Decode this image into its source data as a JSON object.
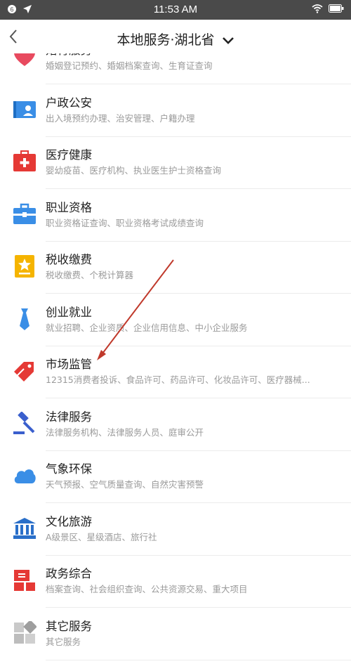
{
  "status": {
    "time": "11:53 AM"
  },
  "header": {
    "title": "本地服务·湖北省"
  },
  "items": [
    {
      "title": "婚育服务",
      "sub": "婚姻登记预约、婚姻档案查询、生育证查询",
      "icon": "heart-icon",
      "color": "#e84a5f"
    },
    {
      "title": "户政公安",
      "sub": "出入境预约办理、治安管理、户籍办理",
      "icon": "id-card-icon",
      "color": "#3a8ee6"
    },
    {
      "title": "医疗健康",
      "sub": "婴幼疫苗、医疗机构、执业医生护士资格查询",
      "icon": "medical-kit-icon",
      "color": "#e53935"
    },
    {
      "title": "职业资格",
      "sub": "职业资格证查询、职业资格考试成绩查询",
      "icon": "briefcase-icon",
      "color": "#3a8ee6"
    },
    {
      "title": "税收缴费",
      "sub": "税收缴费、个税计算器",
      "icon": "tax-star-icon",
      "color": "#f5b400"
    },
    {
      "title": "创业就业",
      "sub": "就业招聘、企业资质、企业信用信息、中小企业服务",
      "icon": "necktie-icon",
      "color": "#3a8ee6"
    },
    {
      "title": "市场监管",
      "sub": "12315消费者投诉、食品许可、药品许可、化妆品许可、医疗器械...",
      "icon": "price-tag-icon",
      "color": "#e53935"
    },
    {
      "title": "法律服务",
      "sub": "法律服务机构、法律服务人员、庭审公开",
      "icon": "gavel-icon",
      "color": "#3a5fcd"
    },
    {
      "title": "气象环保",
      "sub": "天气预报、空气质量查询、自然灾害预警",
      "icon": "cloud-icon",
      "color": "#3a8ee6"
    },
    {
      "title": "文化旅游",
      "sub": "A级景区、星级酒店、旅行社",
      "icon": "museum-icon",
      "color": "#2a6fc9"
    },
    {
      "title": "政务综合",
      "sub": "档案查询、社会组织查询、公共资源交易、重大项目",
      "icon": "org-chart-icon",
      "color": "#e53935"
    },
    {
      "title": "其它服务",
      "sub": "其它服务",
      "icon": "grid-icon",
      "color": "#9e9e9e"
    }
  ]
}
